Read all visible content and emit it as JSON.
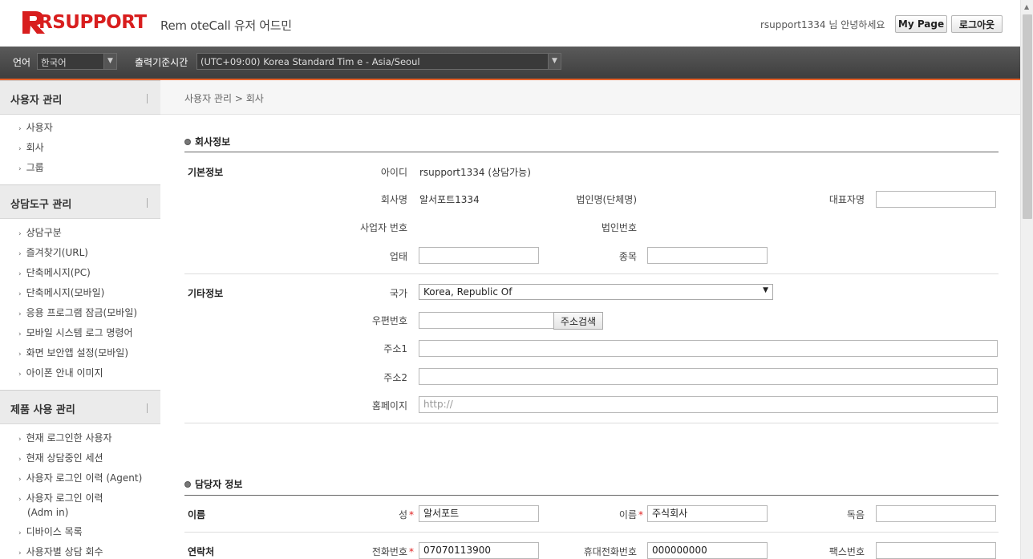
{
  "header": {
    "logo_text": "RSUPPORT",
    "app_title": "Rem oteCall 유저 어드민",
    "greeting": "rsupport1334 님 안녕하세요",
    "mypage_label": "My Page",
    "logout_label": "로그아웃",
    "brand_color": "#d81e1e"
  },
  "toolbar": {
    "language_label": "언어",
    "language_value": "한국어",
    "timezone_label": "출력기준시간",
    "timezone_value": "(UTC+09:00) Korea Standard Tim e - Asia/Seoul",
    "accent_color": "#e8622a"
  },
  "sidebar": {
    "sections": [
      {
        "title": "사용자 관리",
        "items": [
          "사용자",
          "회사",
          "그룹"
        ]
      },
      {
        "title": "상담도구 관리",
        "items": [
          "상담구분",
          "즐겨찾기(URL)",
          "단축메시지(PC)",
          "단축메시지(모바일)",
          "응용 프로그램 잠금(모바일)",
          "모바일 시스템 로그 명령어",
          "화면 보안앱 설정(모바일)",
          "아이폰 안내 이미지"
        ]
      },
      {
        "title": "제품 사용 관리",
        "items": [
          "현재 로그인한 사용자",
          "현재 상담중인 세션",
          "사용자 로그인 이력 (Agent)",
          "사용자 로그인 이력",
          "(Adm in)",
          "디바이스 목록",
          "사용자별 상담 회수"
        ]
      }
    ]
  },
  "breadcrumb": "사용자 관리 > 회사",
  "company": {
    "section_title": "회사정보",
    "basic_label": "기본정보",
    "id_label": "아이디",
    "id_value": "rsupport1334 (상담가능)",
    "company_name_label": "회사명",
    "company_name_value": "알서포트1334",
    "corp_name_label": "법인명(단체명)",
    "ceo_label": "대표자명",
    "biz_no_label": "사업자 번호",
    "corp_no_label": "법인번호",
    "biz_type_label": "업태",
    "biz_item_label": "종목",
    "other_label": "기타정보",
    "country_label": "국가",
    "country_value": "Korea, Republic Of",
    "zip_label": "우편번호",
    "zip_button": "주소검색",
    "addr1_label": "주소1",
    "addr2_label": "주소2",
    "homepage_label": "홈페이지",
    "homepage_placeholder": "http://"
  },
  "manager": {
    "section_title": "담당자 정보",
    "name_group": "이름",
    "surname_label": "성",
    "surname_value": "알서포트",
    "given_label": "이름",
    "given_value": "주식회사",
    "reading_label": "독음",
    "contact_group": "연락처",
    "phone_label": "전화번호",
    "phone_value": "07070113900",
    "mobile_label": "휴대전화번호",
    "mobile_value": "000000000",
    "fax_label": "팩스번호"
  }
}
